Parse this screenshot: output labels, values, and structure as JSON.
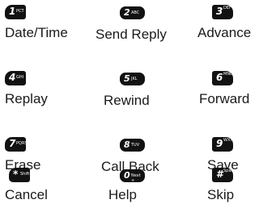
{
  "keys": [
    {
      "digit": "1",
      "letters": "PCT",
      "label": "Date/Time"
    },
    {
      "digit": "2",
      "letters": "ABC",
      "label": "Send Reply"
    },
    {
      "digit": "3",
      "letters": "DEF",
      "label": "Advance"
    },
    {
      "digit": "4",
      "letters": "GHI",
      "label": "Replay"
    },
    {
      "digit": "5",
      "letters": "JKL",
      "label": "Rewind"
    },
    {
      "digit": "6",
      "letters": "MNO",
      "label": "Forward"
    },
    {
      "digit": "7",
      "letters": "PQRS",
      "label": "Erase"
    },
    {
      "digit": "8",
      "letters": "TUV",
      "label": "Call Back"
    },
    {
      "digit": "9",
      "letters": "WXYZ",
      "label": "Save"
    },
    {
      "digit": "*",
      "letters": "Shift",
      "label": "Cancel"
    },
    {
      "digit": "0",
      "letters": "Next +",
      "label": "Help"
    },
    {
      "digit": "#",
      "letters": "Space",
      "label": "Skip"
    }
  ]
}
